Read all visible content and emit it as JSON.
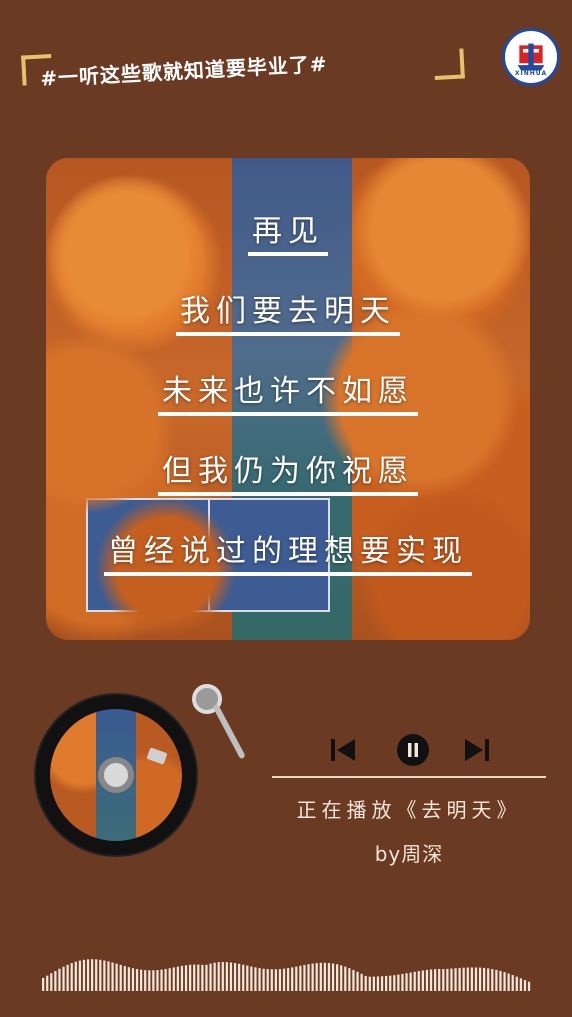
{
  "header": {
    "hashtag": "#一听这些歌就知道要毕业了#",
    "logo_text": "XINHUA"
  },
  "lyrics": [
    "再见",
    "我们要去明天",
    "未来也许不如愿",
    "但我仍为你祝愿",
    "曾经说过的理想要实现"
  ],
  "player": {
    "now_playing": "正在播放《去明天》",
    "artist": "by周深",
    "state": "playing",
    "icons": {
      "prev": "skip-previous-icon",
      "pause": "pause-icon",
      "next": "skip-next-icon"
    }
  },
  "colors": {
    "background": "#6b3a22",
    "accent_bracket": "#e7c26b",
    "text": "#f3e6da"
  }
}
